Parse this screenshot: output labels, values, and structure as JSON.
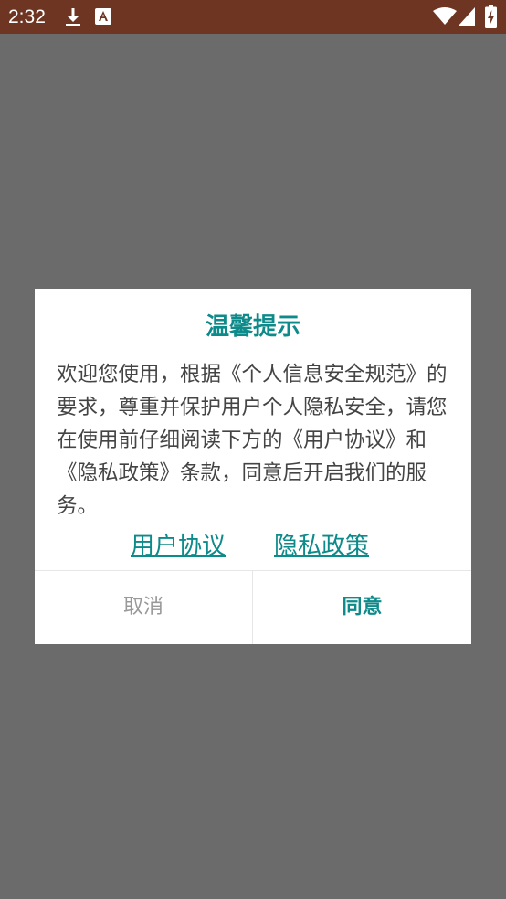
{
  "status_bar": {
    "time": "2:32",
    "icons": [
      "download-icon",
      "a-notification-icon",
      "wifi-icon",
      "signal-icon",
      "battery-icon"
    ]
  },
  "dialog": {
    "title": "温馨提示",
    "body": "欢迎您使用，根据《个人信息安全规范》的要求，尊重并保护用户个人隐私安全，请您在使用前仔细阅读下方的《用户协议》和《隐私政策》条款，同意后开启我们的服务。",
    "links": {
      "user_agreement": "用户协议",
      "privacy_policy": "隐私政策"
    },
    "buttons": {
      "cancel": "取消",
      "agree": "同意"
    }
  },
  "colors": {
    "accent": "#0d8a8a",
    "status_bar": "#6e3622",
    "scrim": "#6b6b6b"
  }
}
